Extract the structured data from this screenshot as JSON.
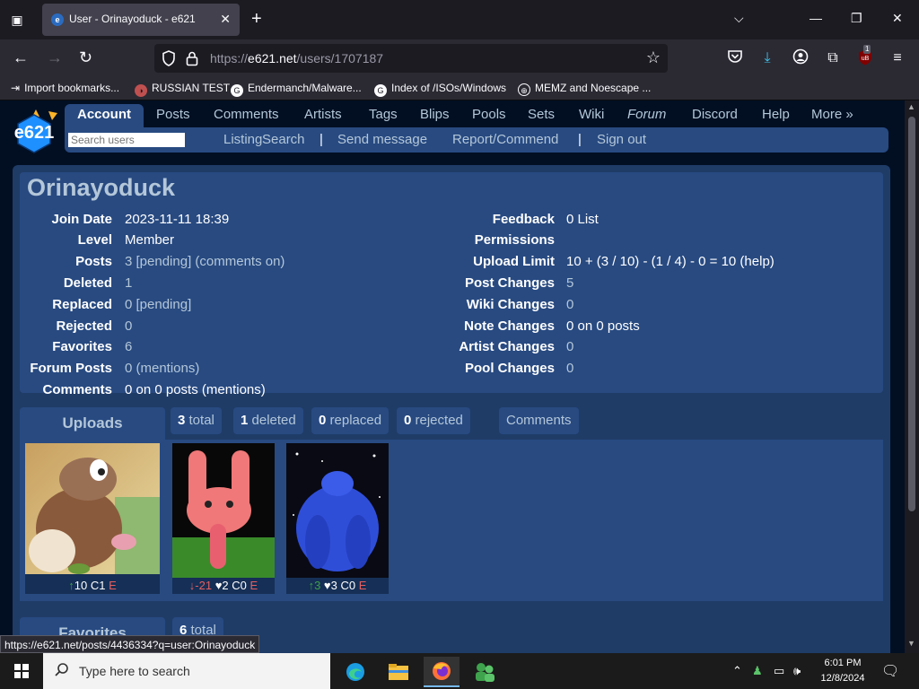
{
  "browser": {
    "tab_title": "User - Orinayoduck - e621",
    "url_prefix": "https://",
    "url_domain": "e621.net",
    "url_path": "/users/1707187",
    "extension_badge": "1",
    "bookmarks": [
      "Import bookmarks...",
      "RUSSIAN TEST",
      "Endermanch/Malware...",
      "Index of /ISOs/Windows",
      "MEMZ and Noescape ..."
    ],
    "status_url": "https://e621.net/posts/4436334?q=user:Orinayoduck"
  },
  "site": {
    "logo_text": "e621",
    "nav": [
      "Account",
      "Posts",
      "Comments",
      "Artists",
      "Tags",
      "Blips",
      "Pools",
      "Sets",
      "Wiki",
      "Forum",
      "Discord",
      "Help",
      "More »"
    ],
    "search_placeholder": "Search users",
    "subnav": [
      "Listing",
      "Search",
      "Send message",
      "Report/Commend",
      "Sign out"
    ],
    "subnav_sep": "|"
  },
  "user": {
    "name": "Orinayoduck",
    "left_stats": [
      {
        "label": "Join Date",
        "value": "2023-11-11 18:39"
      },
      {
        "label": "Level",
        "value": "Member"
      },
      {
        "label": "Posts",
        "value": "3 [pending] (comments on)"
      },
      {
        "label": "Deleted",
        "value": "1"
      },
      {
        "label": "Replaced",
        "value": "0 [pending]"
      },
      {
        "label": "Rejected",
        "value": "0"
      },
      {
        "label": "Favorites",
        "value": "6"
      },
      {
        "label": "Forum Posts",
        "value": "0 (mentions)"
      },
      {
        "label": "Comments",
        "value": "0 on 0 posts (mentions)"
      }
    ],
    "right_stats": [
      {
        "label": "Feedback",
        "value": "0 List"
      },
      {
        "label": "Permissions",
        "value": ""
      },
      {
        "label": "Upload Limit",
        "value": "10 + (3 / 10) - (1 / 4) - 0 = 10 (help)"
      },
      {
        "label": "Post Changes",
        "value": "5"
      },
      {
        "label": "Wiki Changes",
        "value": "0"
      },
      {
        "label": "Note Changes",
        "value": "0 on 0 posts"
      },
      {
        "label": "Artist Changes",
        "value": "0"
      },
      {
        "label": "Pool Changes",
        "value": "0"
      }
    ]
  },
  "uploads": {
    "title": "Uploads",
    "chips": [
      {
        "count": "3",
        "label": "total"
      },
      {
        "count": "1",
        "label": "deleted"
      },
      {
        "count": "0",
        "label": "replaced"
      },
      {
        "count": "0",
        "label": "rejected"
      },
      {
        "count": "",
        "label": "Comments"
      }
    ],
    "posts": [
      {
        "score_arrow": "↑",
        "score": "",
        "favs": "10",
        "comments": "C1",
        "rating": "E",
        "dir": "up"
      },
      {
        "score_arrow": "↓",
        "score": "-21",
        "favs": "♥2",
        "comments": "C0",
        "rating": "E",
        "dir": "down"
      },
      {
        "score_arrow": "↑",
        "score": "3",
        "favs": "♥3",
        "comments": "C0",
        "rating": "E",
        "dir": "up"
      }
    ]
  },
  "favorites": {
    "title": "Favorites",
    "count": "6",
    "label": "total"
  },
  "taskbar": {
    "search_placeholder": "Type here to search",
    "time": "6:01 PM",
    "date": "12/8/2024"
  }
}
